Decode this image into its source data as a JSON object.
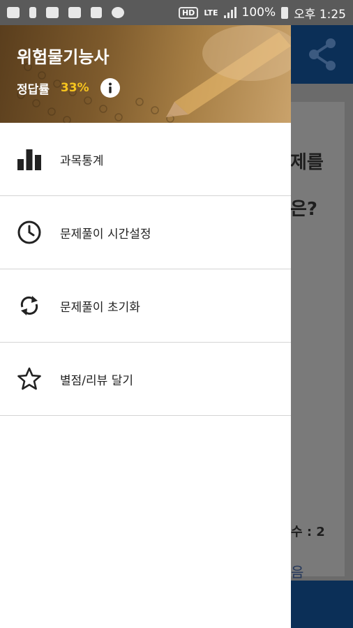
{
  "status_bar": {
    "hd": "HD",
    "network": "LTE",
    "battery": "100%",
    "time": "오후 1:25"
  },
  "drawer": {
    "title": "위험물기능사",
    "rate_label": "정답률",
    "rate_value": "33%",
    "items": [
      {
        "label": "과목통계",
        "icon": "bar-chart-icon"
      },
      {
        "label": "문제풀이 시간설정",
        "icon": "clock-icon"
      },
      {
        "label": "문제풀이 초기화",
        "icon": "refresh-icon"
      },
      {
        "label": "별점/리뷰 달기",
        "icon": "star-icon"
      }
    ]
  },
  "background": {
    "question_line1": "제를",
    "question_line2": "은?",
    "count": "수 : 2",
    "next": "음"
  },
  "colors": {
    "accent": "#f7c51e",
    "app_bar": "#0b2f57",
    "scrim": "#5a5a5a"
  }
}
